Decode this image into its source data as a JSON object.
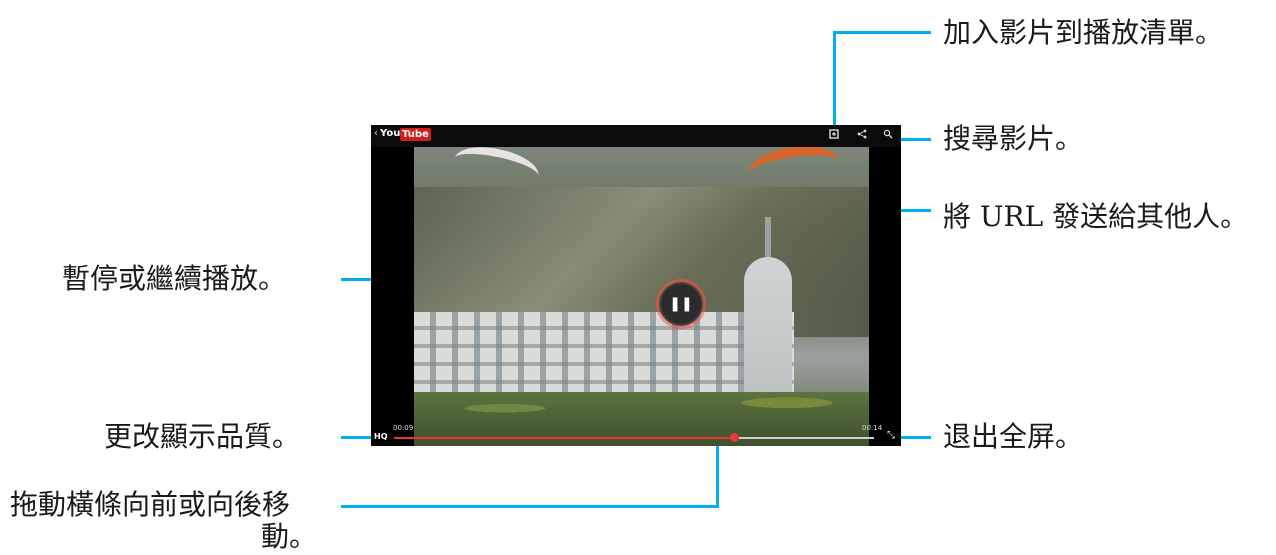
{
  "player": {
    "back_glyph": "‹",
    "brand_you": "You",
    "brand_tube": "Tube",
    "add_playlist_icon": "add-to-playlist-icon",
    "share_icon": "share-icon",
    "search_icon": "search-icon",
    "pause_glyph": "❚❚",
    "time_current": "00:09",
    "time_end": "00:14",
    "hq_label": "HQ",
    "progress": 0.71,
    "fullscreen_exit_glyph": "⤡"
  },
  "callouts": {
    "add_playlist": "加入影片到播放清單。",
    "search": "搜尋影片。",
    "share": "將 URL 發送給其他人。",
    "pause": "暫停或繼續播放。",
    "quality": "更改顯示品質。",
    "exit_fullscreen": "退出全屏。",
    "seek_line1": "拖動橫條向前或向後移",
    "seek_line2": "動。"
  },
  "colors": {
    "callout_line": "#00aeef",
    "progress": "#e53935",
    "youtube_red": "#d41c1c"
  }
}
